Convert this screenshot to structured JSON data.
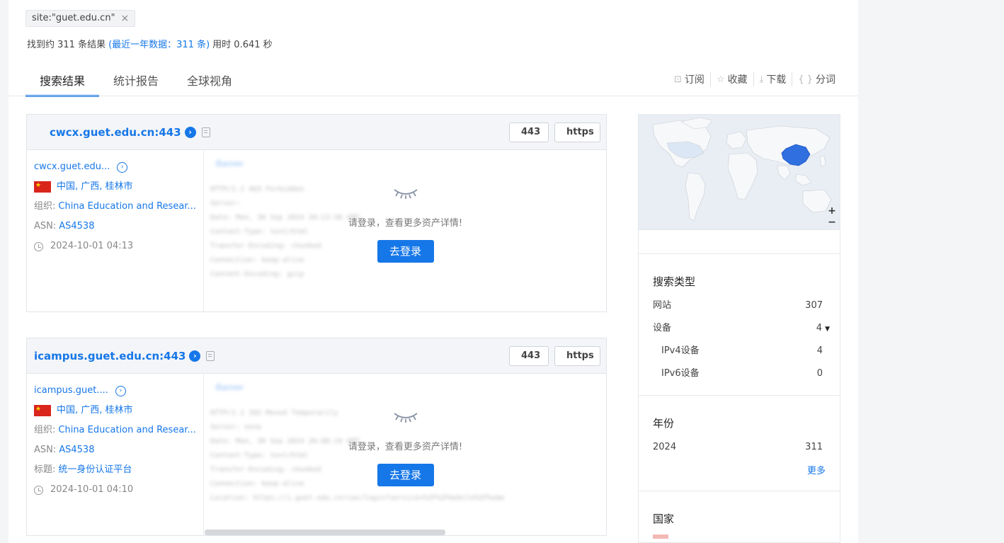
{
  "query": {
    "tag_text": "site:\"guet.edu.cn\"",
    "close_glyph": "×"
  },
  "summary": {
    "prefix": "找到约 311 条结果",
    "recent": "(最近一年数据：311 条)",
    "time": "用时 0.641 秒"
  },
  "tabs": [
    {
      "label": "搜索结果",
      "active": true
    },
    {
      "label": "统计报告",
      "active": false
    },
    {
      "label": "全球视角",
      "active": false
    }
  ],
  "actions": [
    {
      "icon": "bookmark-icon",
      "glyph": "⊡",
      "label": "订阅"
    },
    {
      "icon": "star-icon",
      "glyph": "☆",
      "label": "收藏"
    },
    {
      "icon": "download-icon",
      "glyph": "⤓",
      "label": "下载"
    },
    {
      "icon": "braces-icon",
      "glyph": "{ }",
      "label": "分词"
    }
  ],
  "results": [
    {
      "host": "cwcx.guet.edu.cn:443",
      "port": "443",
      "protocol": "https",
      "link_host": "cwcx.guet.edu...",
      "location": "中国, 广西, 桂林市",
      "org_label": "组织: ",
      "org": "China Education and Resear...",
      "asn_label": "ASN: ",
      "asn": "AS4538",
      "title_label": "",
      "title": "",
      "time": "2024-10-01 04:13",
      "blur_tab": "Banner",
      "blur_lines": [
        "HTTP/1.1 403 Forbidden",
        "Server:",
        "Date: Mon, 30 Sep 2024 20:13:38 GMT",
        "Content-Type: text/html",
        "Transfer-Encoding: chunked",
        "Connection: keep-alive",
        "Content-Encoding: gzip"
      ],
      "login_tip": "请登录，查看更多资产详情!",
      "login_btn": "去登录"
    },
    {
      "host": "icampus.guet.edu.cn:443",
      "port": "443",
      "protocol": "https",
      "link_host": "icampus.guet....",
      "location": "中国, 广西, 桂林市",
      "org_label": "组织: ",
      "org": "China Education and Resear...",
      "asn_label": "ASN: ",
      "asn": "AS4538",
      "title_label": "标题: ",
      "title": "统一身份认证平台",
      "time": "2024-10-01 04:10",
      "blur_tab": "Banner",
      "blur_lines": [
        "HTTP/1.1 302 Moved Temporarily",
        "Server: none",
        "Date: Mon, 30 Sep 2024 20:08:19 GMT",
        "Content-Type: text/html",
        "Transfer-Encoding: chunked",
        "Connection: keep-alive",
        "Location: https://i.guet.edu.cn/cas/login?service=%2F%2Fmobile%2Fhome"
      ],
      "login_tip": "请登录，查看更多资产详情!",
      "login_btn": "去登录"
    }
  ],
  "sidebar": {
    "zoom_in": "+",
    "zoom_out": "−",
    "search_type": {
      "title": "搜索类型",
      "rows": [
        {
          "label": "网站",
          "count": "307"
        },
        {
          "label": "设备",
          "count": "4",
          "caret": "▼"
        },
        {
          "label": "IPv4设备",
          "count": "4",
          "sub": true
        },
        {
          "label": "IPv6设备",
          "count": "0",
          "sub": true
        }
      ]
    },
    "year": {
      "title": "年份",
      "rows": [
        {
          "label": "2024",
          "count": "311"
        }
      ],
      "more": "更多"
    },
    "country": {
      "title": "国家"
    }
  },
  "colors": {
    "accent": "#1677e8",
    "highlight_country": "#2f6fe0"
  }
}
